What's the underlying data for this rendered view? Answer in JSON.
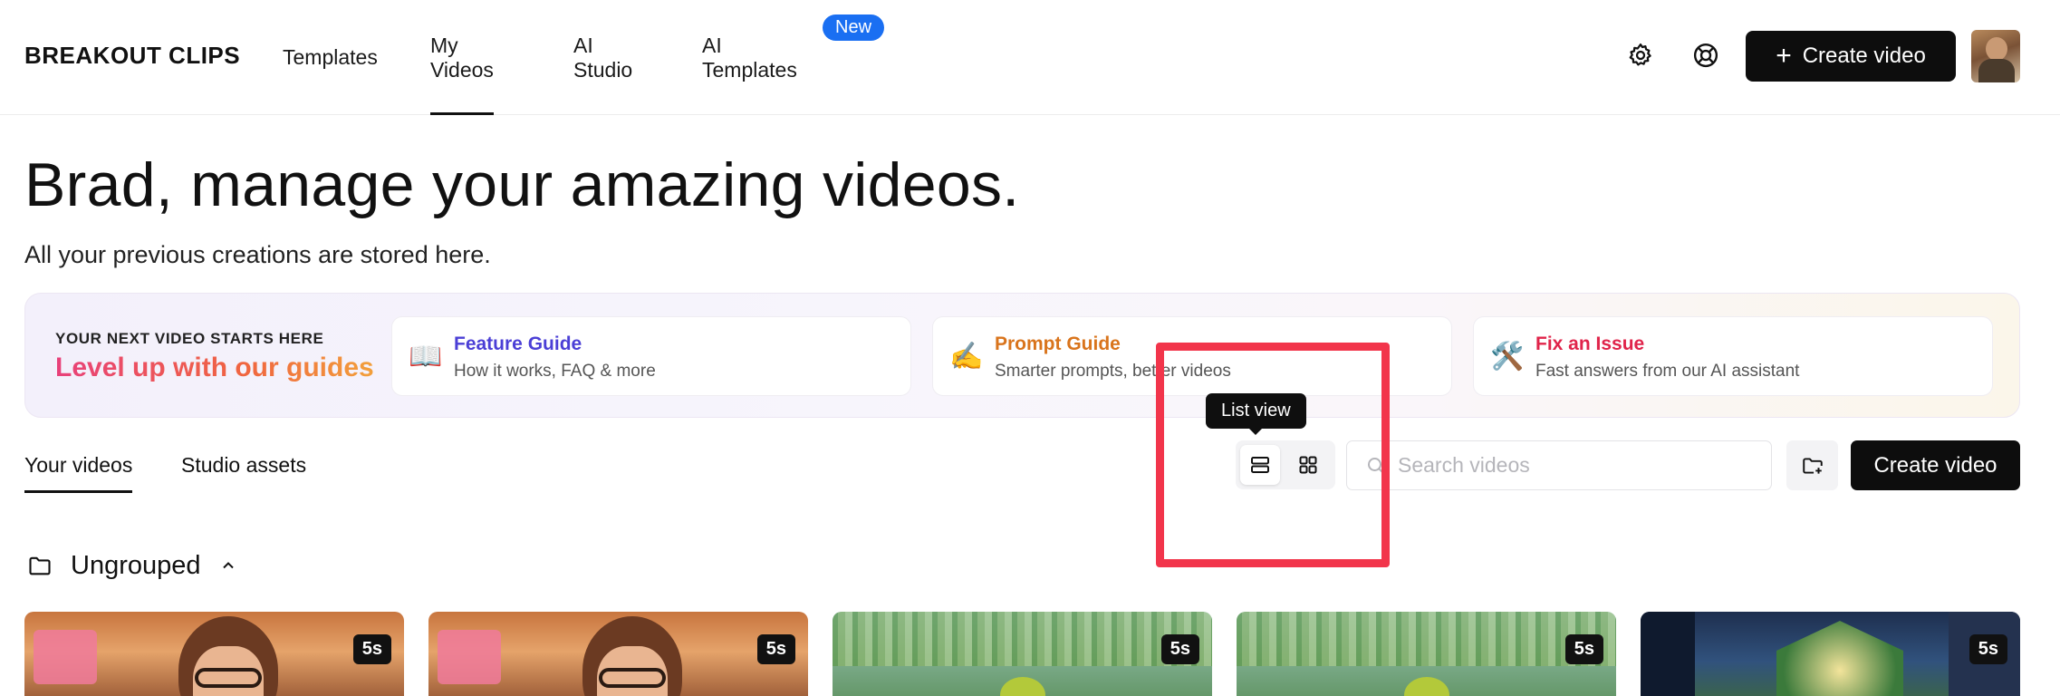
{
  "app": {
    "logo_text": "BREAKOUT CLIPS"
  },
  "nav": {
    "items": [
      {
        "label": "Templates",
        "active": false
      },
      {
        "label": "My Videos",
        "active": true
      },
      {
        "label": "AI Studio",
        "active": false
      },
      {
        "label": "AI Templates",
        "active": false
      }
    ],
    "new_badge": "New"
  },
  "header_actions": {
    "settings_icon": "gear-icon",
    "help_icon": "lifebuoy-icon",
    "create_label": "Create video"
  },
  "hero": {
    "title": "Brad, manage your amazing videos.",
    "subtitle": "All your previous creations are stored here."
  },
  "guides": {
    "kicker": "YOUR NEXT VIDEO STARTS HERE",
    "heading": "Level up with our guides",
    "cards": [
      {
        "emoji": "📖",
        "title": "Feature Guide",
        "desc": "How it works, FAQ & more",
        "color": "#4b3fd6"
      },
      {
        "emoji": "✍️",
        "title": "Prompt Guide",
        "desc": "Smarter prompts, better videos",
        "color": "#d9741c"
      },
      {
        "emoji": "🛠️",
        "title": "Fix an Issue",
        "desc": "Fast answers from our AI assistant",
        "color": "#e0244a"
      }
    ]
  },
  "tabs": [
    {
      "label": "Your videos",
      "active": true
    },
    {
      "label": "Studio assets",
      "active": false
    }
  ],
  "toolbar": {
    "tooltip": "List view",
    "search_placeholder": "Search videos",
    "create_label": "Create video",
    "active_view": "list"
  },
  "group": {
    "label": "Ungrouped",
    "expanded": true
  },
  "videos": [
    {
      "duration": "5s",
      "scene": "girl-cafe"
    },
    {
      "duration": "5s",
      "scene": "girl-cafe"
    },
    {
      "duration": "5s",
      "scene": "frog-pond"
    },
    {
      "duration": "5s",
      "scene": "frog-pond"
    },
    {
      "duration": "5s",
      "scene": "city-squirrel"
    }
  ],
  "colors": {
    "highlight": "#f2354b",
    "new_badge": "#1a6ff2",
    "primary_button": "#0d0d0d"
  }
}
